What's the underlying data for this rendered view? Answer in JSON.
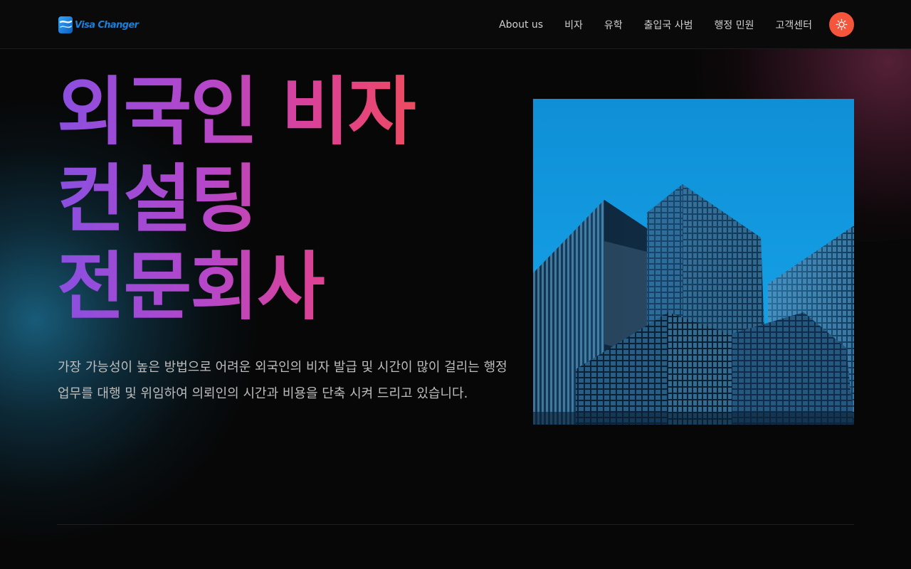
{
  "header": {
    "logo_text": "Visa Changer",
    "nav": [
      {
        "label": "About us"
      },
      {
        "label": "비자"
      },
      {
        "label": "유학"
      },
      {
        "label": "출입국 사범"
      },
      {
        "label": "행정 민원"
      },
      {
        "label": "고객센터"
      }
    ],
    "theme_icon": "sun-icon"
  },
  "hero": {
    "title_lines": [
      "외국인 비자",
      "컨설팅",
      "전문회사"
    ],
    "description": "가장 가능성이 높은 방법으로 어려운 외국인의 비자 발급 및 시간이 많이 걸리는 행정업무를 대행 및 위임하여 의뢰인의 시간과 비용을 단축 시켜 드리고 있습니다.",
    "image_icon": "office-building-photo"
  },
  "colors": {
    "accent": "#f4553b",
    "gradient_start": "#8a4fe0",
    "gradient_mid": "#e2418c",
    "gradient_end": "#f4553b",
    "background": "#070707",
    "logo_blue": "#1d7fd6"
  }
}
